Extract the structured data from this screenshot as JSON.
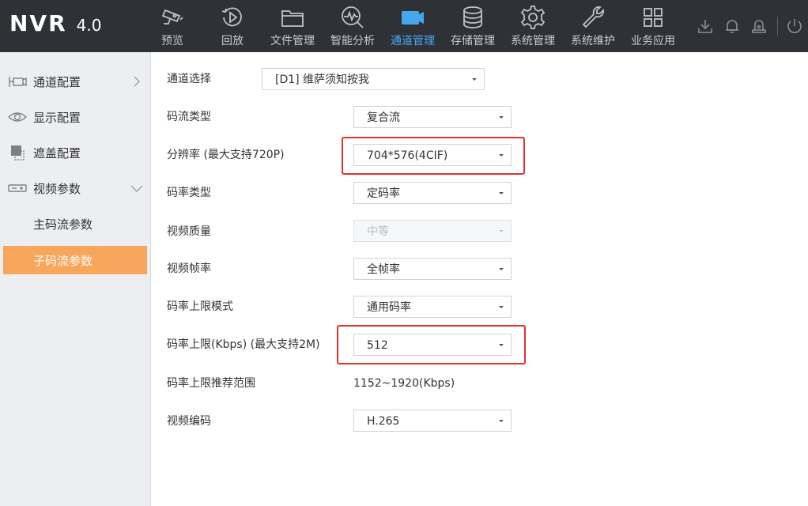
{
  "app": {
    "logo": "NVR",
    "version": "4.0"
  },
  "nav": {
    "items": [
      {
        "label": "预览",
        "icon": "camera-preview-icon",
        "active": false
      },
      {
        "label": "回放",
        "icon": "playback-icon",
        "active": false
      },
      {
        "label": "文件管理",
        "icon": "folder-icon",
        "active": false
      },
      {
        "label": "智能分析",
        "icon": "smart-analysis-icon",
        "active": false
      },
      {
        "label": "通道管理",
        "icon": "channel-camera-icon",
        "active": true
      },
      {
        "label": "存储管理",
        "icon": "database-icon",
        "active": false
      },
      {
        "label": "系统管理",
        "icon": "gear-icon",
        "active": false
      },
      {
        "label": "系统维护",
        "icon": "wrench-icon",
        "active": false
      },
      {
        "label": "业务应用",
        "icon": "grid-apps-icon",
        "active": false
      }
    ],
    "active_color": "#45a7f0",
    "tools": [
      "download-icon",
      "bell-icon",
      "alarm-icon",
      "power-icon"
    ]
  },
  "sidebar": {
    "items": [
      {
        "label": "通道配置",
        "icon": "channel-config-icon"
      },
      {
        "label": "显示配置",
        "icon": "eye-icon"
      },
      {
        "label": "遮盖配置",
        "icon": "mask-icon"
      },
      {
        "label": "视频参数",
        "icon": "video-params-icon"
      }
    ],
    "subitems": [
      {
        "label": "主码流参数",
        "active": false
      },
      {
        "label": "子码流参数",
        "active": true
      }
    ],
    "active_color": "#f8a65b"
  },
  "form": {
    "channel_label": "通道选择",
    "channel_value": "[D1] 维萨须知按我",
    "stream_type_label": "码流类型",
    "stream_type_value": "复合流",
    "resolution_label": "分辨率 (最大支持720P)",
    "resolution_value": "704*576(4CIF)",
    "bitrate_type_label": "码率类型",
    "bitrate_type_value": "定码率",
    "quality_label": "视频质量",
    "quality_value": "中等",
    "framerate_label": "视频帧率",
    "framerate_value": "全帧率",
    "bitrate_mode_label": "码率上限模式",
    "bitrate_mode_value": "通用码率",
    "bitrate_max_label": "码率上限(Kbps) (最大支持2M)",
    "bitrate_max_value": "512",
    "bitrate_range_label": "码率上限推荐范围",
    "bitrate_range_value": "1152~1920(Kbps)",
    "codec_label": "视频编码",
    "codec_value": "H.265"
  },
  "highlight_color": "#e0312e"
}
